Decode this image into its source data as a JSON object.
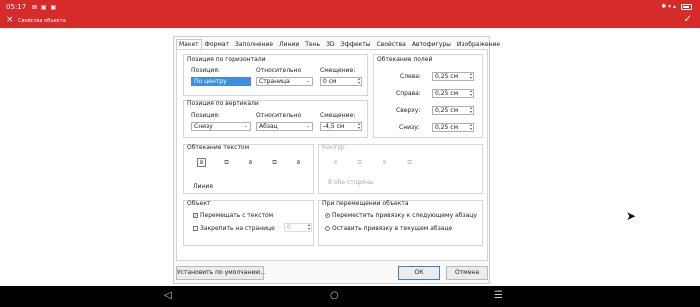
{
  "statusbar": {
    "time": "05:17",
    "mini_icons": "⊠ ▣ ▣",
    "right_icons": "✱ ▾ ▴"
  },
  "window": {
    "title": "Свойства объекта"
  },
  "tabs": [
    "Макет",
    "Формат",
    "Заполнение",
    "Линии",
    "Тень",
    "3D",
    "Эффекты",
    "Свойства",
    "Автофигуры",
    "Изображение"
  ],
  "horizontal": {
    "title": "Позиция по горизонтали",
    "position_label": "Позиция:",
    "position_value": "По центру",
    "relative_label": "Относительно",
    "relative_value": "Страница",
    "offset_label": "Смещение:",
    "offset_value": "0 см"
  },
  "vertical": {
    "title": "Позиция по вертикали",
    "position_label": "Позиция:",
    "position_value": "Снизу",
    "relative_label": "Относительно",
    "relative_value": "Абзац",
    "offset_label": "Смещение:",
    "offset_value": "-4,5 см"
  },
  "field_wrap": {
    "title": "Обтекание полей",
    "left_label": "Слева:",
    "left_value": "0,25 см",
    "right_label": "Справа:",
    "right_value": "0,25 см",
    "top_label": "Сверху:",
    "top_value": "0,25 см",
    "bottom_label": "Снизу:",
    "bottom_value": "0,25 см"
  },
  "text_wrap": {
    "title": "Обтекание текстом",
    "caption": "Линия"
  },
  "contour": {
    "title": "Контур",
    "caption": "В обе стороны"
  },
  "object": {
    "title": "Объект",
    "move_with_text": "Перемещать с текстом",
    "pin_on_page": "Закрепить на странице",
    "pin_value": "0"
  },
  "on_move": {
    "title": "При перемещении объекта",
    "option1": "Переместить привязку к следующему абзацу",
    "option2": "Оставить привязку в текущем абзаце"
  },
  "buttons": {
    "default": "Установить по умолчанию...",
    "ok": "ОК",
    "cancel": "Отмена"
  },
  "colors": {
    "accent": "#d52b2b",
    "selection": "#3d8ee0"
  }
}
